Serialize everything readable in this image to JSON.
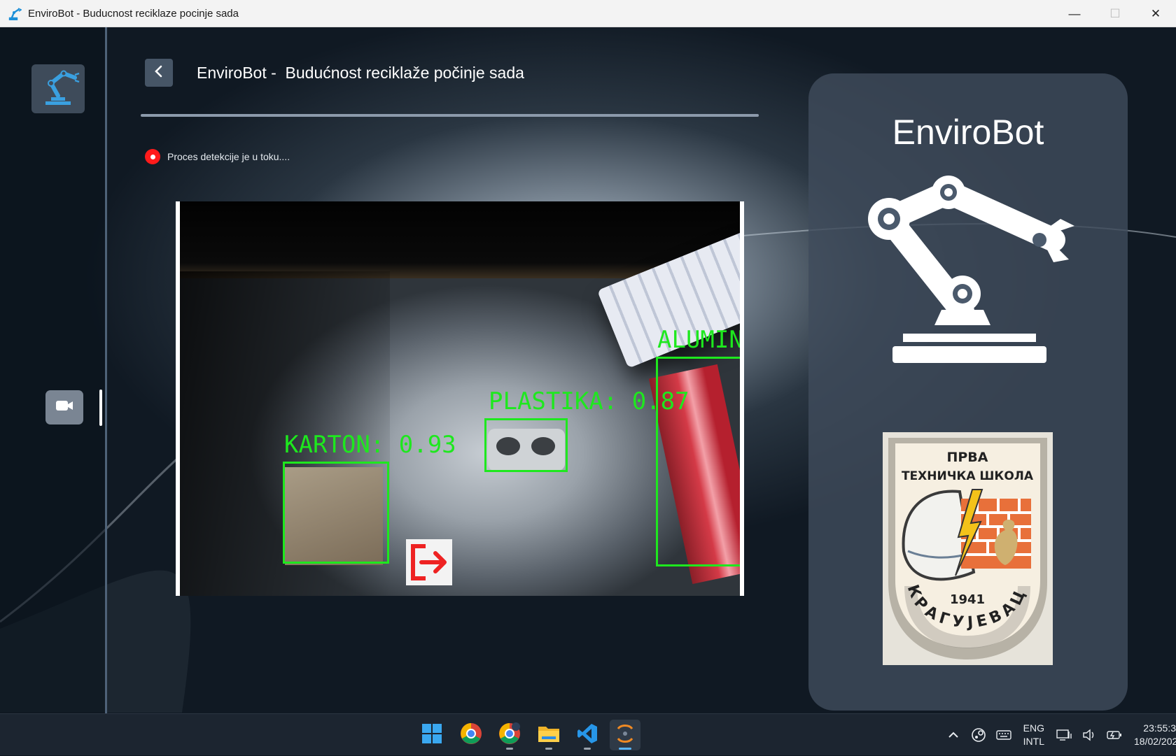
{
  "window": {
    "title": "EnviroBot - Buducnost reciklaze pocinje sada",
    "minimize_glyph": "—",
    "maximize_glyph": "☐",
    "close_glyph": "✕"
  },
  "header": {
    "title": "EnviroBot -  Budućnost reciklaže počinje sada"
  },
  "status": {
    "text": "Proces detekcije je u toku...."
  },
  "detections": [
    {
      "label": "KARTON:  0.93"
    },
    {
      "label": "PLASTIKA:  0.87"
    },
    {
      "label": "ALUMIN"
    }
  ],
  "right_panel": {
    "title": "EnviroBot",
    "emblem": {
      "line1": "ПРВА",
      "line2": "ТЕХНИЧКА ШКОЛА",
      "year": "1941",
      "city": "КРАГУЈЕВАЦ"
    }
  },
  "nav": {
    "items": [
      {
        "icon": "robot-arm-icon"
      },
      {
        "icon": "video-camera-icon"
      }
    ]
  },
  "taskbar": {
    "apps": [
      "windows-start-icon",
      "chrome-icon",
      "chrome-profile-icon",
      "file-explorer-icon",
      "vscode-icon",
      "java-app-icon"
    ],
    "lang_line1": "ENG",
    "lang_line2": "INTL",
    "time": "23:55:3",
    "date": "18/02/202"
  },
  "colors": {
    "detection_green": "#1ee81e",
    "status_red": "#ff1b1b",
    "accent_blue": "#3aa0e0"
  }
}
